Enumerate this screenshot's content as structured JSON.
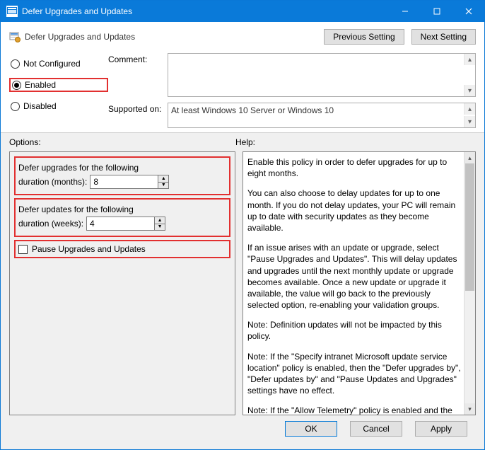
{
  "titlebar": {
    "title": "Defer Upgrades and Updates"
  },
  "header": {
    "heading": "Defer Upgrades and Updates",
    "prev": "Previous Setting",
    "next": "Next Setting"
  },
  "state": {
    "not_configured": "Not Configured",
    "enabled": "Enabled",
    "disabled": "Disabled",
    "selected": "enabled"
  },
  "comment": {
    "label": "Comment:",
    "value": ""
  },
  "supported": {
    "label": "Supported on:",
    "value": "At least Windows 10 Server or Windows 10"
  },
  "options": {
    "label": "Options:",
    "defer_upgrades_line1": "Defer upgrades for the following",
    "defer_upgrades_line2_prefix": "duration (months):",
    "defer_upgrades_value": "8",
    "defer_updates_line1": "Defer updates for the following",
    "defer_updates_line2_prefix": "duration (weeks):",
    "defer_updates_value": "4",
    "pause_label": "Pause Upgrades and Updates",
    "pause_checked": false
  },
  "help": {
    "label": "Help:",
    "p1": "Enable this policy in order to defer upgrades for up to eight months.",
    "p2": "You can also choose to delay updates for up to one month. If you do not delay updates, your PC will remain up to date with security updates as they become available.",
    "p3": "If an issue arises with an update or upgrade, select \"Pause Upgrades and Updates\". This will delay updates and upgrades until the next monthly update or upgrade becomes available. Once a new update or upgrade it available, the value will go back to the previously selected option, re-enabling your validation groups.",
    "p4": "Note: Definition updates will not be impacted by this policy.",
    "p5": "Note: If the \"Specify intranet Microsoft update service location\" policy is enabled, then the \"Defer upgrades by\", \"Defer updates by\" and \"Pause Updates and Upgrades\" settings have no effect.",
    "p6": "Note: If the \"Allow Telemetry\" policy is enabled and the Options"
  },
  "footer": {
    "ok": "OK",
    "cancel": "Cancel",
    "apply": "Apply"
  }
}
